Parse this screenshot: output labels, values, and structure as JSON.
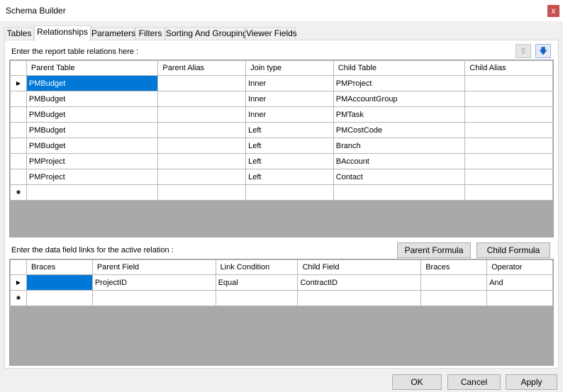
{
  "window": {
    "title": "Schema Builder",
    "close_glyph": "x"
  },
  "tabs": [
    {
      "label": "Tables"
    },
    {
      "label": "Relationships"
    },
    {
      "label": "Parameters"
    },
    {
      "label": "Filters"
    },
    {
      "label": "Sorting And Grouping"
    },
    {
      "label": "Viewer Fields"
    }
  ],
  "relations": {
    "caption": "Enter the report table relations here :",
    "move_up_icon": "arrow-up-icon",
    "move_down_icon": "arrow-down-icon",
    "columns": [
      "Parent Table",
      "Parent Alias",
      "Join type",
      "Child Table",
      "Child Alias"
    ],
    "current_row_glyph": "▶",
    "new_row_glyph": "✱",
    "rows": [
      [
        "PMBudget",
        "",
        "Inner",
        "PMProject",
        ""
      ],
      [
        "PMBudget",
        "",
        "Inner",
        "PMAccountGroup",
        ""
      ],
      [
        "PMBudget",
        "",
        "Inner",
        "PMTask",
        ""
      ],
      [
        "PMBudget",
        "",
        "Left",
        "PMCostCode",
        ""
      ],
      [
        "PMBudget",
        "",
        "Left",
        "Branch",
        ""
      ],
      [
        "PMProject",
        "",
        "Left",
        "BAccount",
        ""
      ],
      [
        "PMProject",
        "",
        "Left",
        "Contact",
        ""
      ]
    ]
  },
  "links": {
    "caption": "Enter the data field links for the active relation :",
    "parent_formula_label": "Parent Formula",
    "child_formula_label": "Child Formula",
    "columns": [
      "Braces",
      "Parent Field",
      "Link Condition",
      "Child Field",
      "Braces",
      "Operator"
    ],
    "current_row_glyph": "▶",
    "new_row_glyph": "✱",
    "rows": [
      [
        "",
        "ProjectID",
        "Equal",
        "ContractID",
        "",
        "And"
      ]
    ]
  },
  "footer": {
    "ok_label": "OK",
    "cancel_label": "Cancel",
    "apply_label": "Apply"
  },
  "colors": {
    "selection": "#0078d7",
    "grid_empty": "#a9a9a9",
    "close_button": "#c75050"
  }
}
